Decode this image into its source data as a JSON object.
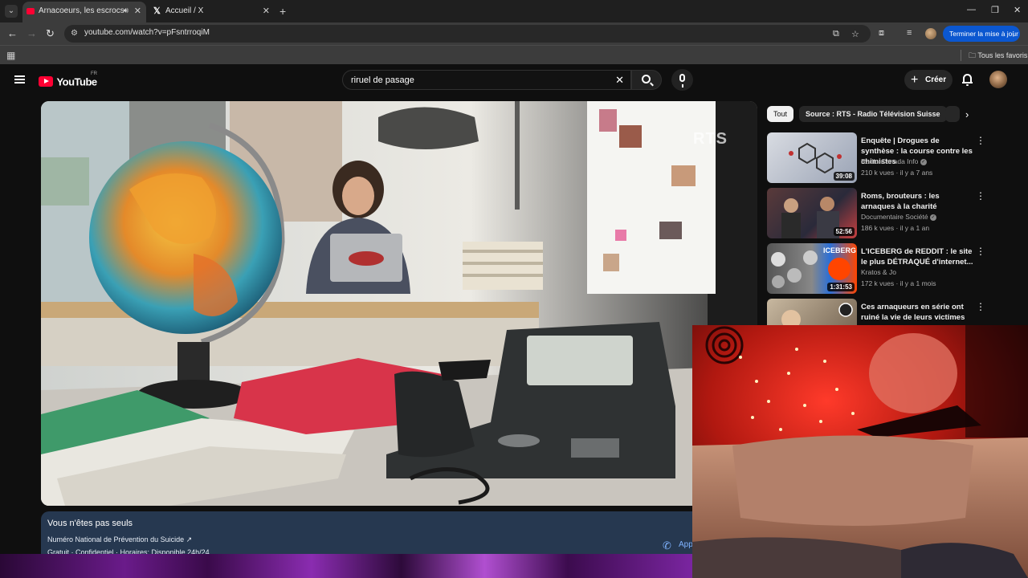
{
  "browser": {
    "tabs": [
      {
        "title": "Arnacoeurs, les escrocs de l'a",
        "active": true
      },
      {
        "title": "Accueil / X",
        "active": false
      }
    ],
    "url": "youtube.com/watch?v=pFsntrroqiM",
    "update_label": "Terminer la mise à jour",
    "bookmarks_folder": "Tous les favoris"
  },
  "youtube": {
    "country": "FR",
    "logo_text": "YouTube",
    "search_query": "riruel de pasage",
    "create_label": "Créer",
    "watermark": "RTS",
    "chips": [
      "Tout",
      "Source : RTS - Radio Télévision Suisse"
    ],
    "crisis": {
      "title": "Vous n'êtes pas seuls",
      "line": "Numéro National de Prévention du Suicide ↗",
      "info": "Gratuit · Confidentiel · Horaires: Disponible 24h/24",
      "action": "Appeler"
    },
    "suggestions": [
      {
        "title": "Enquête | Drogues de synthèse : la course contre les chimistes",
        "channel": "Radio-Canada Info",
        "verified": true,
        "meta": "210 k vues · il y a 7 ans",
        "duration": "39:08"
      },
      {
        "title": "Roms, brouteurs : les arnaques à la charité",
        "channel": "Documentaire Société",
        "verified": true,
        "meta": "186 k vues · il y a 1 an",
        "duration": "52:56"
      },
      {
        "title": "L'ICEBERG de REDDIT : le site le plus DÉTRAQUÉ d'internet...",
        "channel": "Kratos & Jo",
        "verified": false,
        "meta": "172 k vues · il y a 1 mois",
        "duration": "1:31:53"
      },
      {
        "title": "Ces arnaqueurs en série ont ruiné la vie de leurs victimes",
        "channel": "",
        "verified": false,
        "meta": "",
        "duration": ""
      }
    ]
  },
  "colors": {
    "youtube_red": "#ff0033",
    "chrome_blue": "#0b57d0",
    "crisis_bg": "#263850"
  },
  "icons": [
    "tab-search-icon",
    "speaker-icon",
    "close-icon",
    "new-tab-icon",
    "back-icon",
    "forward-icon",
    "reload-icon",
    "site-info-icon",
    "install-icon",
    "star-icon",
    "extensions-icon",
    "media-icon",
    "apps-icon",
    "folder-icon",
    "menu-icon",
    "search-icon",
    "clear-icon",
    "mic-icon",
    "plus-icon",
    "bell-icon",
    "chevron-right-icon",
    "more-vert-icon",
    "phone-icon",
    "watch-later-icon"
  ]
}
